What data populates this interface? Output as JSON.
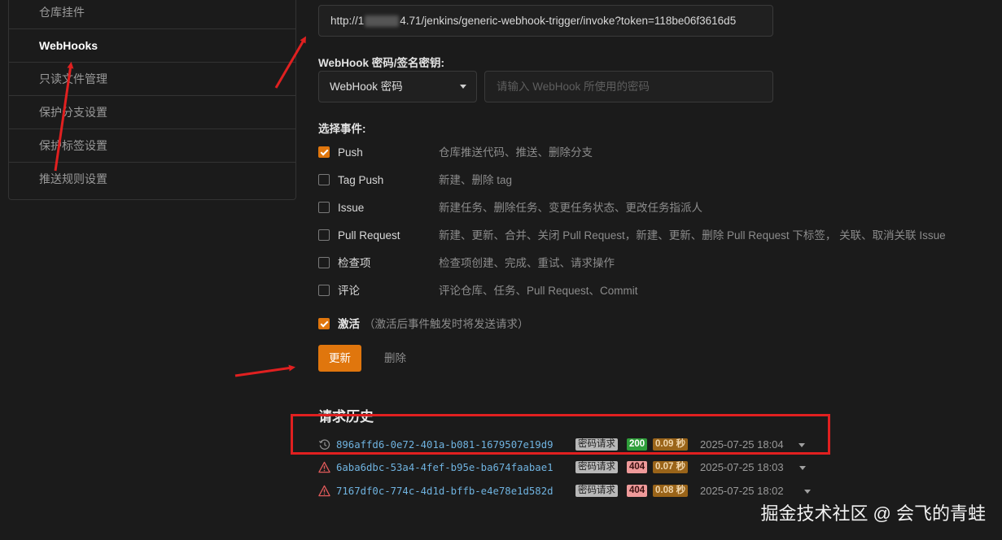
{
  "sidebar": {
    "items": [
      {
        "label": "仓库挂件"
      },
      {
        "label": "WebHooks"
      },
      {
        "label": "只读文件管理"
      },
      {
        "label": "保护分支设置"
      },
      {
        "label": "保护标签设置"
      },
      {
        "label": "推送规则设置"
      }
    ]
  },
  "url": {
    "prefix": "http://1",
    "suffix": "4.71/jenkins/generic-webhook-trigger/invoke?token=118be06f3616d5"
  },
  "secret": {
    "label": "WebHook 密码/签名密钥:",
    "type_selected": "WebHook 密码",
    "placeholder": "请输入 WebHook 所使用的密码"
  },
  "events": {
    "label": "选择事件:",
    "items": [
      {
        "name": "Push",
        "desc": "仓库推送代码、推送、删除分支",
        "checked": true
      },
      {
        "name": "Tag Push",
        "desc": "新建、删除 tag",
        "checked": false
      },
      {
        "name": "Issue",
        "desc": "新建任务、删除任务、变更任务状态、更改任务指派人",
        "checked": false
      },
      {
        "name": "Pull Request",
        "desc": "新建、更新、合并、关闭 Pull Request，新建、更新、删除 Pull Request 下标签， 关联、取消关联 Issue",
        "checked": false
      },
      {
        "name": "检查项",
        "desc": "检查项创建、完成、重试、请求操作",
        "checked": false
      },
      {
        "name": "评论",
        "desc": "评论仓库、任务、Pull Request、Commit",
        "checked": false
      }
    ]
  },
  "activate": {
    "label": "激活",
    "hint": "（激活后事件触发时将发送请求）",
    "checked": true
  },
  "actions": {
    "update": "更新",
    "delete": "删除"
  },
  "history": {
    "title": "请求历史",
    "items": [
      {
        "id": "896affd6-0e72-401a-b081-1679507e19d9",
        "type": "密码请求",
        "status": "200",
        "duration": "0.09 秒",
        "time": "2025-07-25 18:04",
        "icon": "history-icon"
      },
      {
        "id": "6aba6dbc-53a4-4fef-b95e-ba674faabae1",
        "type": "密码请求",
        "status": "404",
        "duration": "0.07 秒",
        "time": "2025-07-25 18:03",
        "icon": "warning-icon"
      },
      {
        "id": "7167df0c-774c-4d1d-bffb-e4e78e1d582d",
        "type": "密码请求",
        "status": "404",
        "duration": "0.08 秒",
        "time": "2025-07-25 18:02",
        "icon": "warning-icon"
      }
    ]
  },
  "watermark": "掘金技术社区 @ 会飞的青蛙",
  "colors": {
    "accent": "#e0760d",
    "annotation": "#e02020",
    "success": "#2f9e3a",
    "error": "#ef9a9a"
  }
}
